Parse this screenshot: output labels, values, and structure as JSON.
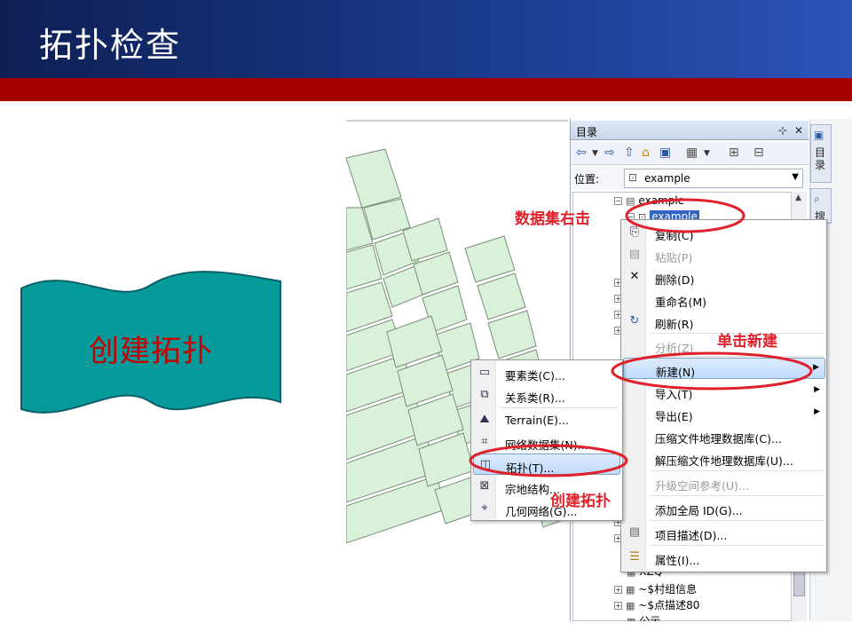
{
  "slide": {
    "title": "拓扑检查",
    "banner_text": "创建拓扑",
    "colors": {
      "header_dark": "#0e1f54",
      "header_light": "#2b54b8",
      "red_bar": "#a50000",
      "banner": "#079a9a",
      "annotation": "#e0202a"
    }
  },
  "catalog": {
    "title": "目录",
    "title_buttons": [
      "pin-icon",
      "close-icon"
    ],
    "location_label": "位置:",
    "location_value": "example",
    "tree": {
      "root": "example",
      "selected": "example",
      "items_below": [
        "XZQ",
        "~$村组信息",
        "~$点描述80",
        "公示"
      ]
    },
    "dock_tabs": [
      {
        "icon": "catalog-icon",
        "label": "目录"
      },
      {
        "icon": "search-icon",
        "label": "搜"
      }
    ]
  },
  "context_menu": {
    "items": [
      {
        "icon": "copy-icon",
        "label": "复制(C)",
        "enabled": true
      },
      {
        "icon": "paste-icon",
        "label": "粘贴(P)",
        "enabled": false
      },
      {
        "icon": "delete-icon",
        "label": "删除(D)",
        "enabled": true
      },
      {
        "icon": "",
        "label": "重命名(M)",
        "enabled": true
      },
      {
        "icon": "refresh-icon",
        "label": "刷新(R)",
        "enabled": true
      },
      {
        "icon": "",
        "label": "分析(Z)",
        "enabled": false
      },
      {
        "icon": "",
        "label": "新建(N)",
        "enabled": true,
        "submenu": true,
        "highlighted": true
      },
      {
        "icon": "",
        "label": "导入(T)",
        "enabled": true,
        "submenu": true
      },
      {
        "icon": "",
        "label": "导出(E)",
        "enabled": true,
        "submenu": true
      },
      {
        "icon": "",
        "label": "压缩文件地理数据库(C)...",
        "enabled": true
      },
      {
        "icon": "",
        "label": "解压缩文件地理数据库(U)...",
        "enabled": true
      },
      {
        "icon": "",
        "label": "升级空间参考(U)...",
        "enabled": false
      },
      {
        "icon": "",
        "label": "添加全局 ID(G)...",
        "enabled": true
      },
      {
        "icon": "metadata-icon",
        "label": "项目描述(D)...",
        "enabled": true
      },
      {
        "icon": "properties-icon",
        "label": "属性(I)...",
        "enabled": true
      }
    ]
  },
  "new_submenu": {
    "items": [
      {
        "icon": "feature-class-icon",
        "label": "要素类(C)..."
      },
      {
        "icon": "relationship-class-icon",
        "label": "关系类(R)..."
      },
      {
        "icon": "terrain-icon",
        "label": "Terrain(E)..."
      },
      {
        "icon": "network-dataset-icon",
        "label": "网络数据集(N)..."
      },
      {
        "icon": "topology-icon",
        "label": "拓扑(T)...",
        "highlighted": true
      },
      {
        "icon": "parcel-fabric-icon",
        "label": "宗地结构..."
      },
      {
        "icon": "geometric-network-icon",
        "label": "几何网络(G)..."
      }
    ]
  },
  "annotations": {
    "right_click_dataset": "数据集右击",
    "click_new": "单击新建",
    "create_topology": "创建拓扑"
  }
}
